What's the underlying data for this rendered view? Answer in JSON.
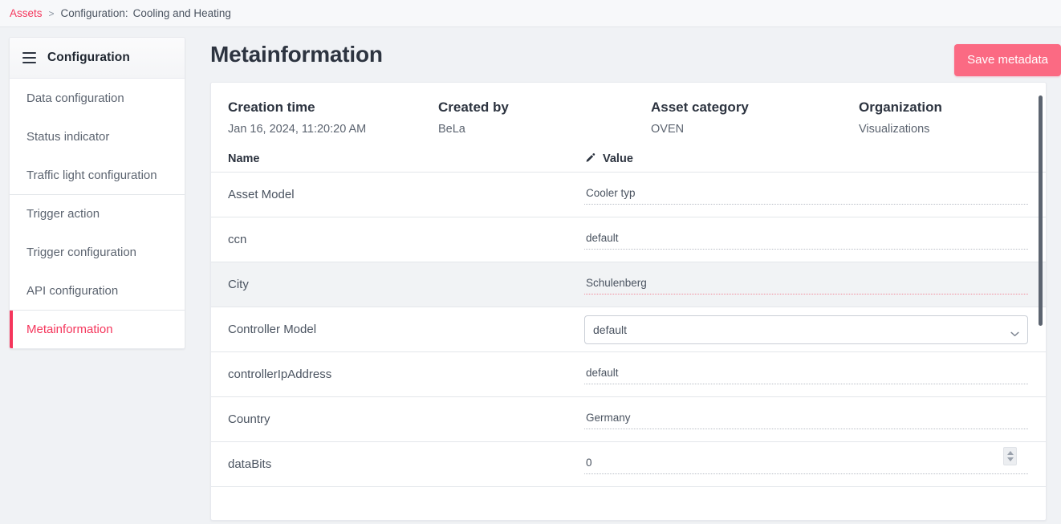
{
  "breadcrumb": {
    "root": "Assets",
    "separator": ">",
    "current_prefix": "Configuration:",
    "current_name": "Cooling and Heating"
  },
  "sidebar": {
    "title": "Configuration",
    "menu_icon": "hamburger-icon",
    "items": [
      {
        "label": "Data configuration",
        "active": false,
        "group_start": false
      },
      {
        "label": "Status indicator",
        "active": false,
        "group_start": false
      },
      {
        "label": "Traffic light configuration",
        "active": false,
        "group_start": false
      },
      {
        "label": "Trigger action",
        "active": false,
        "group_start": true
      },
      {
        "label": "Trigger configuration",
        "active": false,
        "group_start": false
      },
      {
        "label": "API configuration",
        "active": false,
        "group_start": false
      },
      {
        "label": "Metainformation",
        "active": true,
        "group_start": true
      }
    ]
  },
  "header": {
    "title": "Metainformation",
    "save_label": "Save metadata"
  },
  "summary": [
    {
      "label": "Creation time",
      "value": "Jan 16, 2024, 11:20:20 AM"
    },
    {
      "label": "Created by",
      "value": "BeLa"
    },
    {
      "label": "Asset category",
      "value": "OVEN"
    },
    {
      "label": "Organization",
      "value": "Visualizations"
    }
  ],
  "table": {
    "columns": {
      "name": "Name",
      "value": "Value",
      "value_icon": "pencil-icon"
    },
    "rows": [
      {
        "name": "Asset Model",
        "value": "Cooler typ",
        "type": "text",
        "highlight": false,
        "accent": false
      },
      {
        "name": "ccn",
        "value": "default",
        "type": "text",
        "highlight": false,
        "accent": false
      },
      {
        "name": "City",
        "value": "Schulenberg",
        "type": "text",
        "highlight": true,
        "accent": true
      },
      {
        "name": "Controller Model",
        "value": "default",
        "type": "select",
        "highlight": false,
        "accent": false
      },
      {
        "name": "controllerIpAddress",
        "value": "default",
        "type": "text",
        "highlight": false,
        "accent": false
      },
      {
        "name": "Country",
        "value": "Germany",
        "type": "text",
        "highlight": false,
        "accent": false
      },
      {
        "name": "dataBits",
        "value": "0",
        "type": "number",
        "highlight": false,
        "accent": false
      }
    ]
  },
  "colors": {
    "accent": "#f5365c",
    "save_button": "#fb6a83",
    "page_background": "#f0f2f5",
    "text": "#4a5360"
  }
}
